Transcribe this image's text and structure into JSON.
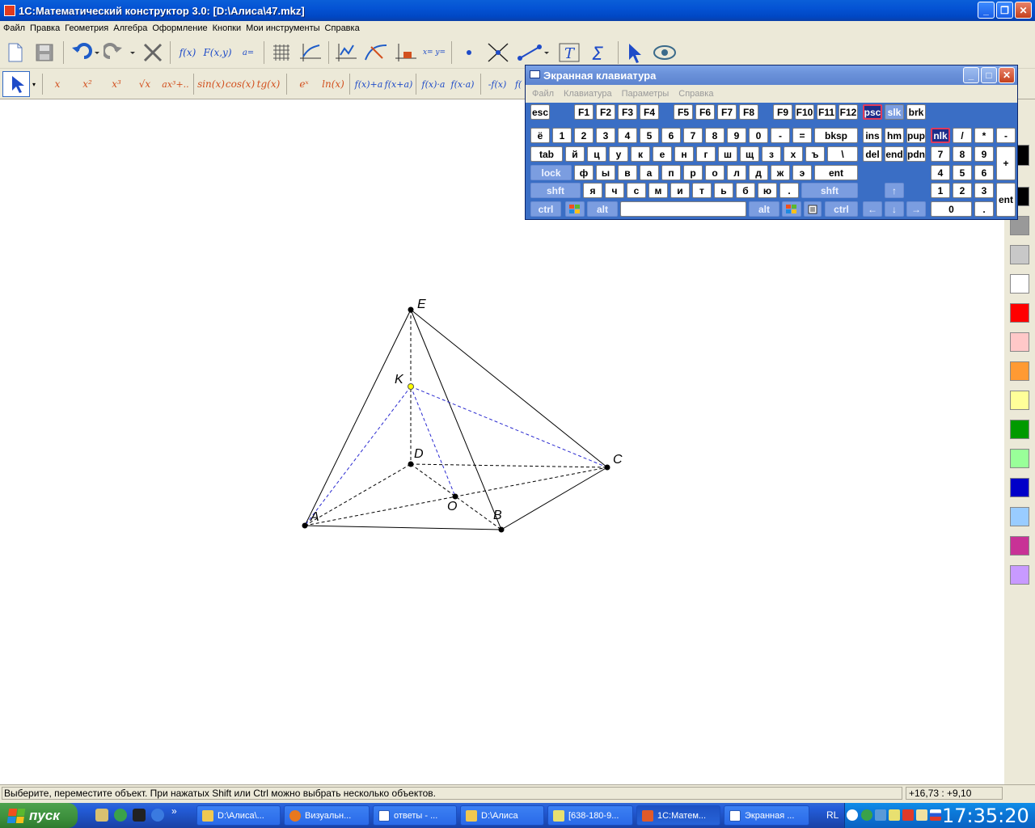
{
  "window": {
    "title": "1С:Математический конструктор 3.0: [D:\\Алиса\\47.mkz]",
    "minimize": "_",
    "maximize": "❐",
    "close": "✕"
  },
  "menu": [
    "Файл",
    "Правка",
    "Геометрия",
    "Алгебра",
    "Оформление",
    "Кнопки",
    "Мои инструменты",
    "Справка"
  ],
  "toolbar1": {
    "f_of_x": "f(x)",
    "F_of_xy": "F(x,y)",
    "a_eq": "a=",
    "xy_eq": "x= y="
  },
  "toolbar2": {
    "x": "x",
    "x2": "x²",
    "x3": "x³",
    "sqrt": "√x",
    "poly": "ax³+..",
    "sin": "sin(x)",
    "cos": "cos(x)",
    "tg": "tg(x)",
    "exp": "eˣ",
    "ln": "ln(x)",
    "shift1": "f(x)+a",
    "shift2": "f(x+a)",
    "scale1": "f(x)·a",
    "scale2": "f(x·a)",
    "neg1": "-f(x)",
    "neg2": "f("
  },
  "figure": {
    "points": [
      {
        "label": "E"
      },
      {
        "label": "K"
      },
      {
        "label": "D"
      },
      {
        "label": "C"
      },
      {
        "label": "O"
      },
      {
        "label": "A"
      },
      {
        "label": "B"
      }
    ]
  },
  "palette": {
    "colors": [
      "#000000",
      "#999999",
      "#c8c8c8",
      "#ffffff",
      "#ff0000",
      "#ffc8c8",
      "#ff9a33",
      "#ffff99",
      "#009a00",
      "#99ff99",
      "#0000c8",
      "#99ccff",
      "#c83296",
      "#c89aff"
    ]
  },
  "status": {
    "text": "Выберите, переместите объект. При нажатых Shift или Ctrl можно выбрать несколько объектов.",
    "coords": "+16,73 : +9,10"
  },
  "osk": {
    "title": "Экранная клавиатура",
    "menu": [
      "Файл",
      "Клавиатура",
      "Параметры",
      "Справка"
    ],
    "keys": {
      "esc": "esc",
      "f1": "F1",
      "f2": "F2",
      "f3": "F3",
      "f4": "F4",
      "f5": "F5",
      "f6": "F6",
      "f7": "F7",
      "f8": "F8",
      "f9": "F9",
      "f10": "F10",
      "f11": "F11",
      "f12": "F12",
      "psc": "psc",
      "slk": "slk",
      "brk": "brk",
      "yo": "ё",
      "d1": "1",
      "d2": "2",
      "d3": "3",
      "d4": "4",
      "d5": "5",
      "d6": "6",
      "d7": "7",
      "d8": "8",
      "d9": "9",
      "d0": "0",
      "minus": "-",
      "equal": "=",
      "bksp": "bksp",
      "ins": "ins",
      "hm": "hm",
      "pup": "pup",
      "nlk": "nlk",
      "div": "/",
      "mul": "*",
      "sub": "-",
      "tab": "tab",
      "r1": [
        "й",
        "ц",
        "у",
        "к",
        "е",
        "н",
        "г",
        "ш",
        "щ",
        "з",
        "х",
        "ъ"
      ],
      "bslash": "\\",
      "del": "del",
      "end": "end",
      "pdn": "pdn",
      "n7": "7",
      "n8": "8",
      "n9": "9",
      "plus": "+",
      "lock": "lock",
      "r2": [
        "ф",
        "ы",
        "в",
        "а",
        "п",
        "р",
        "о",
        "л",
        "д",
        "ж",
        "э"
      ],
      "ent": "ent",
      "n4": "4",
      "n5": "5",
      "n6": "6",
      "shft": "shft",
      "r3": [
        "я",
        "ч",
        "с",
        "м",
        "и",
        "т",
        "ь",
        "б",
        "ю",
        "."
      ],
      "shft2": "shft",
      "up": "↑",
      "n1": "1",
      "n2": "2",
      "n3": "3",
      "nent": "ent",
      "ctrl": "ctrl",
      "alt": "alt",
      "alt2": "alt",
      "ctrl2": "ctrl",
      "left": "←",
      "down": "↓",
      "right": "→",
      "n0": "0",
      "ndot": "."
    }
  },
  "taskbar": {
    "start": "пуск",
    "more": "»",
    "tasks": [
      "D:\\Алиса\\...",
      "Визуальн...",
      "ответы - ...",
      "D:\\Алиса",
      "[638-180-9...",
      "1С:Матем...",
      "Экранная ..."
    ],
    "lang": "RL",
    "clock": "17:35:20"
  }
}
